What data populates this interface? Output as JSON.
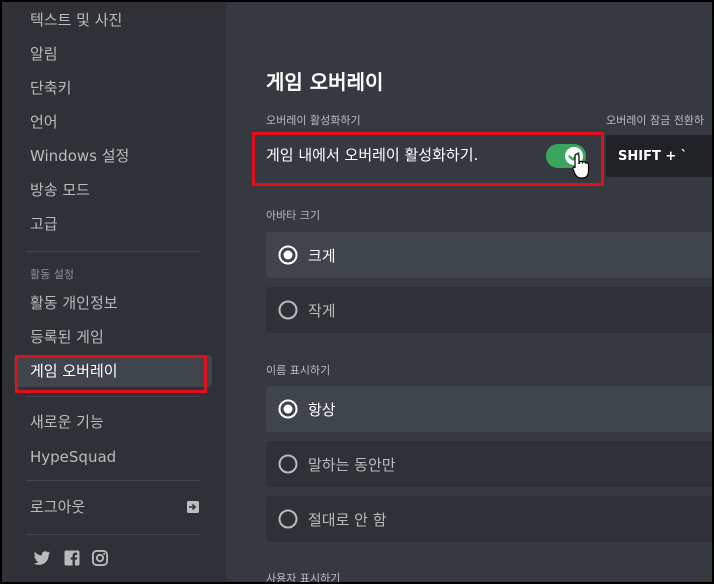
{
  "sidebar": {
    "items_top": [
      "텍스트 및 사진",
      "알림",
      "단축키",
      "언어",
      "Windows 설정",
      "방송 모드",
      "고급"
    ],
    "activity_header": "활동 설정",
    "activity_items": [
      "활동 개인정보",
      "등록된 게임",
      "게임 오버레이"
    ],
    "active_item": "게임 오버레이",
    "whats_new": "새로운 기능",
    "hypesquad": "HypeSquad",
    "logout": "로그아웃",
    "social_icons": [
      "twitter-icon",
      "facebook-icon",
      "instagram-icon"
    ]
  },
  "main": {
    "title": "게임 오버레이",
    "enable_section_label": "오버레이 활성화하기",
    "enable_toggle_label": "게임 내에서 오버레이 활성화하기.",
    "enable_toggle_on": true,
    "lock_section_label": "오버레이 잠금 전환하",
    "lock_keybind": "SHIFT + `",
    "avatar_size_label": "아바타 크기",
    "avatar_options": [
      "크게",
      "작게"
    ],
    "avatar_selected": "크게",
    "display_names_label": "이름 표시하기",
    "display_name_options": [
      "항상",
      "말하는 동안만",
      "절대로 안 함"
    ],
    "display_name_selected": "항상",
    "display_users_label": "사용자 표시하기"
  },
  "colors": {
    "sidebar_bg": "#2f3136",
    "main_bg": "#36393f",
    "toggle_on": "#3ba55c",
    "highlight": "#e0101e"
  }
}
